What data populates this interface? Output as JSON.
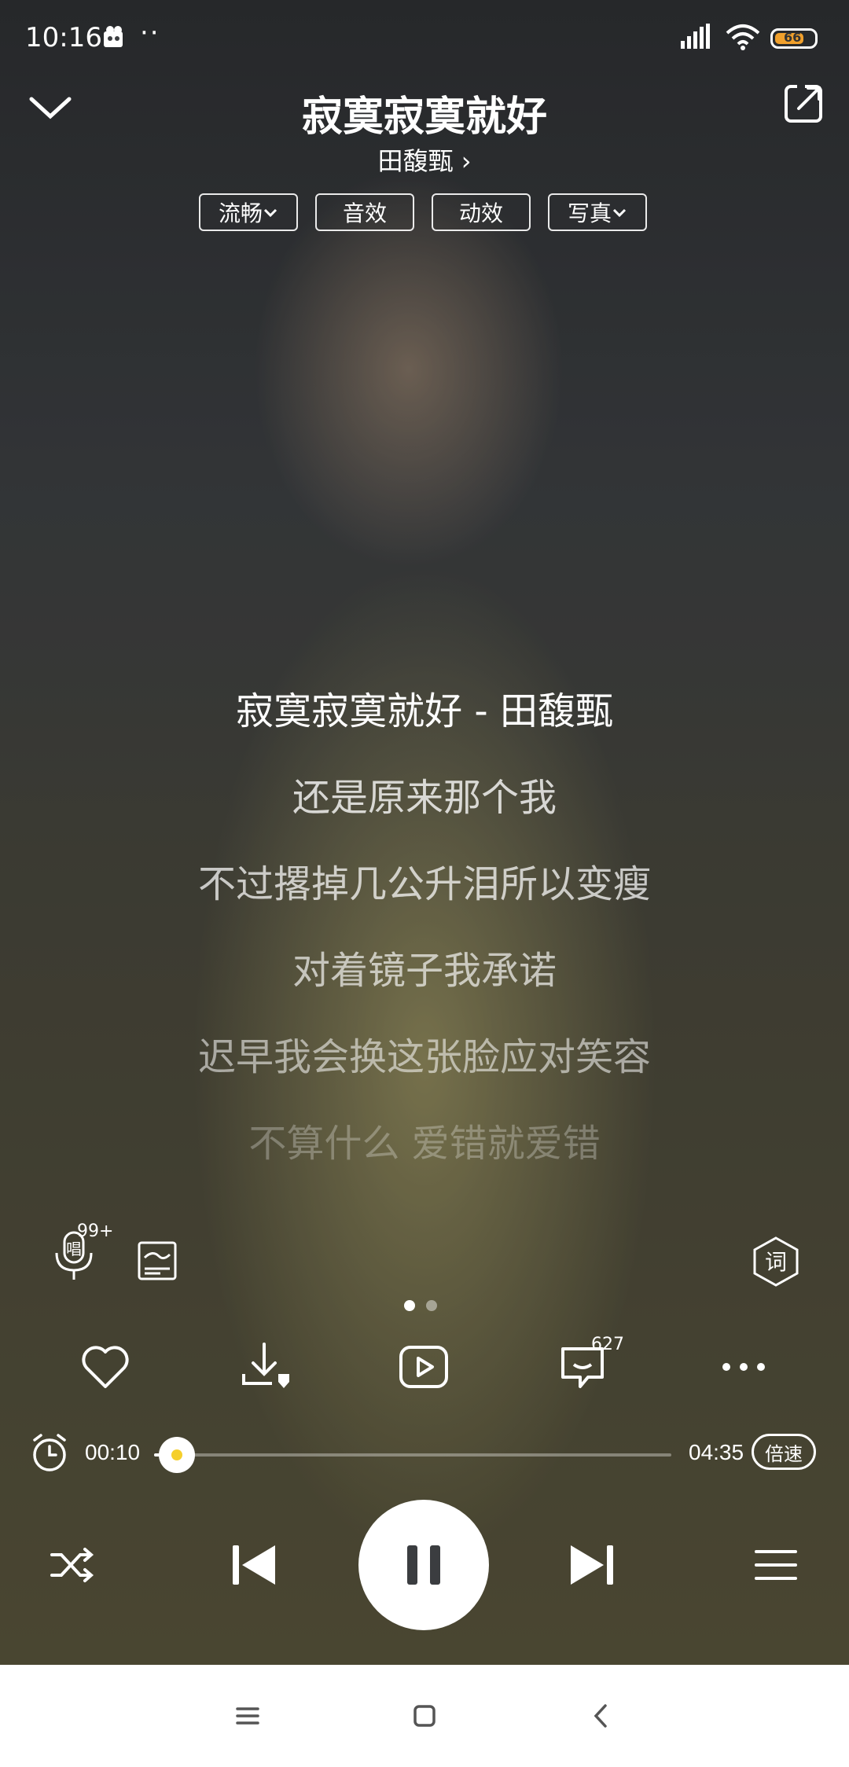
{
  "status_bar": {
    "time": "10:16",
    "dots": "··",
    "battery_level": "66"
  },
  "header": {
    "title": "寂寞寂寞就好",
    "artist": "田馥甄",
    "artist_chevron": "›"
  },
  "options": [
    {
      "label": "流畅",
      "dropdown": true
    },
    {
      "label": "音效",
      "dropdown": false
    },
    {
      "label": "动效",
      "dropdown": false
    },
    {
      "label": "写真",
      "dropdown": true
    }
  ],
  "lyrics": [
    "寂寞寂寞就好 - 田馥甄",
    "还是原来那个我",
    "不过撂掉几公升泪所以变瘦",
    "对着镜子我承诺",
    "迟早我会换这张脸应对笑容",
    "不算什么 爱错就爱错"
  ],
  "tools": {
    "sing_badge": "99+",
    "lyric_button": "词"
  },
  "actions": {
    "comment_count": "627"
  },
  "progress": {
    "current": "00:10",
    "total": "04:35",
    "fraction": 0.036,
    "speed_label": "倍速"
  },
  "icons": {
    "collapse": "chevron-down-icon",
    "share": "share-icon",
    "sing": "microphone-icon",
    "poster": "poster-icon",
    "lyric": "lyric-icon",
    "like": "heart-icon",
    "download": "download-icon",
    "video": "video-icon",
    "comment": "comment-icon",
    "more": "more-icon",
    "timer": "alarm-clock-icon",
    "shuffle": "shuffle-icon",
    "prev": "skip-previous-icon",
    "pause": "pause-icon",
    "next": "skip-next-icon",
    "playlist": "playlist-icon"
  },
  "colors": {
    "accent": "#f5cf2c",
    "navbar": "#ffffff"
  }
}
